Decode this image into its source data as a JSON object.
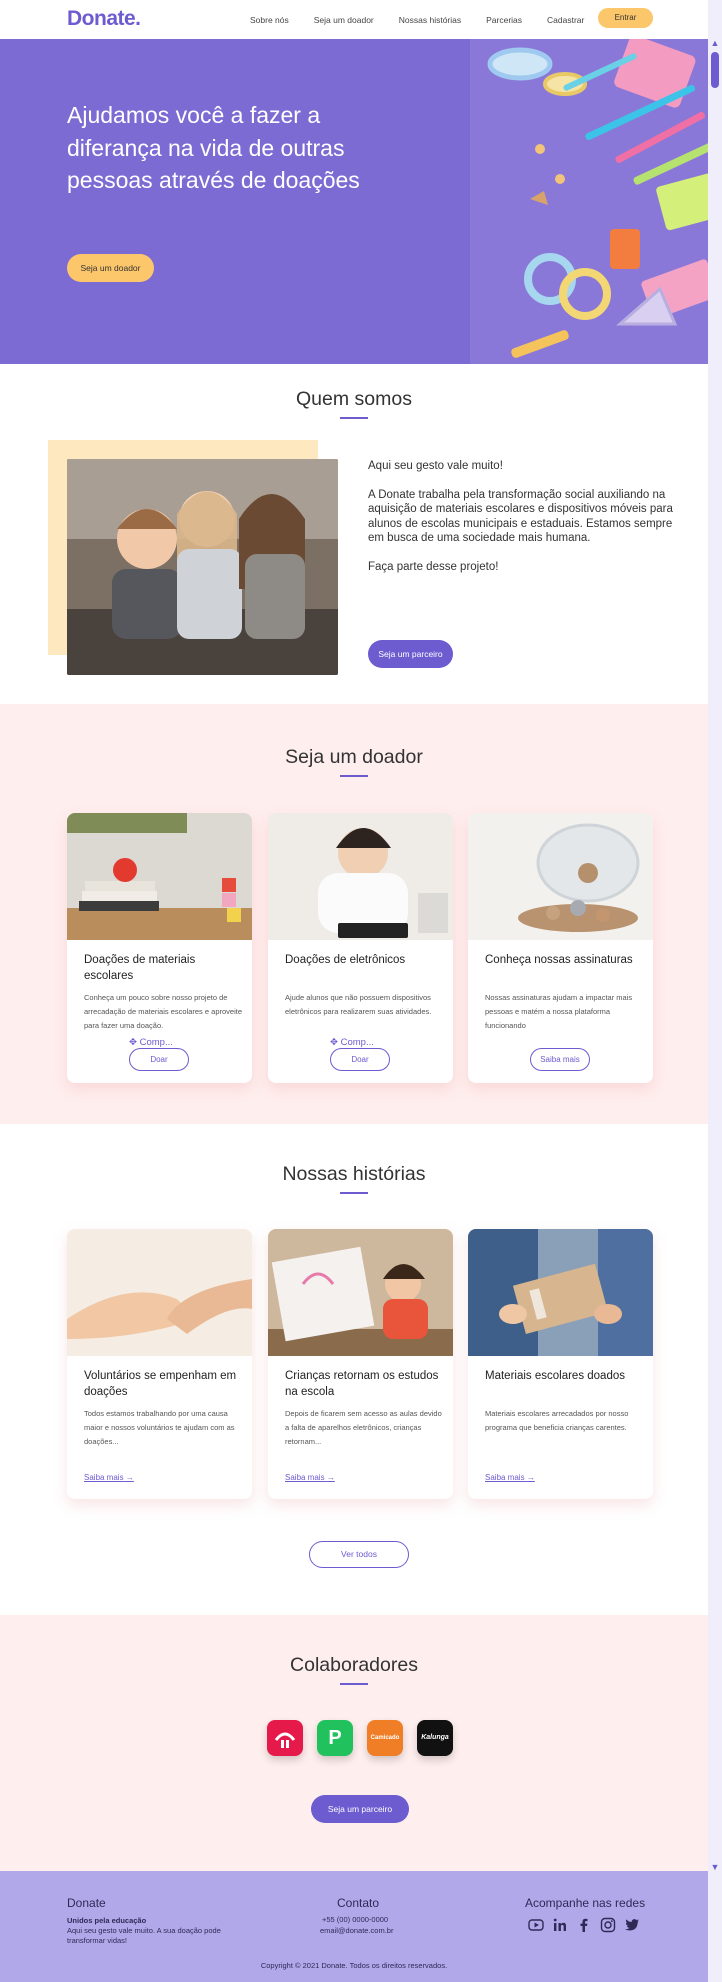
{
  "header": {
    "logo": "Donate.",
    "nav": [
      "Sobre nós",
      "Seja um doador",
      "Nossas histórias",
      "Parcerias",
      "Cadastrar"
    ],
    "login_label": "Entrar"
  },
  "hero": {
    "title": "Ajudamos você a fazer a diferança na vida de outras pessoas através de doações",
    "cta": "Seja um doador"
  },
  "about": {
    "title": "Quem somos",
    "p1": "Aqui seu gesto vale muito!",
    "p2": "A Donate trabalha pela transformação social auxiliando na aquisição de materiais escolares e dispositivos móveis para alunos de escolas municipais e estaduais. Estamos sempre em busca de uma sociedade mais humana.",
    "p3": "Faça parte desse projeto!",
    "cta": "Seja um parceiro"
  },
  "donor": {
    "title": "Seja um doador",
    "comp_tag": "Comp...",
    "cards": [
      {
        "title": "Doações de materiais escolares",
        "desc": "Conheça um pouco sobre nosso projeto de arrecadação de materiais escolares e aproveite para fazer uma doação.",
        "button": "Doar"
      },
      {
        "title": "Doações de eletrônicos",
        "desc": "Ajude alunos que não possuem dispositivos eletrônicos para realizarem suas atividades.",
        "button": "Doar"
      },
      {
        "title": "Conheça nossas assinaturas",
        "desc": "Nossas assinaturas ajudam a impactar mais pessoas e matém a nossa plataforma funcionando",
        "button": "Saiba mais"
      }
    ]
  },
  "stories": {
    "title": "Nossas histórias",
    "link_label": "Saiba mais",
    "see_all": "Ver todos",
    "cards": [
      {
        "title": "Voluntários se empenham em doações",
        "desc": "Todos estamos trabalhando por uma causa maior e nossos voluntários te ajudam com as doações..."
      },
      {
        "title": "Crianças retornam os estudos na escola",
        "desc": "Depois de ficarem sem acesso as aulas devido a falta de aparelhos eletrônicos, crianças retornam..."
      },
      {
        "title": "Materiais escolares doados",
        "desc": "Materiais escolares arrecadados por nosso programa que beneficia crianças carentes."
      }
    ]
  },
  "partners": {
    "title": "Colaboradores",
    "logos": [
      {
        "name": "bradesco-logo",
        "color": "#e6194b"
      },
      {
        "name": "picpay-logo",
        "color": "#21c25e",
        "text": "P"
      },
      {
        "name": "camicado-logo",
        "color": "#f07e26",
        "text": "Camicado"
      },
      {
        "name": "kalunga-logo",
        "color": "#111111",
        "text": "Kalunga"
      }
    ],
    "cta": "Seja um parceiro"
  },
  "footer": {
    "brand": "Donate",
    "tagline": "Unidos pela educação",
    "tagline_text": "Aqui seu gesto vale muito. A sua doação pode transformar vidas!",
    "contact_title": "Contato",
    "phone": "+55 (00) 0000-0000",
    "email": "email@donate.com.br",
    "social_title": "Acompanhe nas redes",
    "copyright": "Copyright © 2021 Donate. Todos os direitos reservados."
  },
  "colors": {
    "primary": "#6d5bd0",
    "accent": "#fcc76b",
    "pink": "#ffeeee",
    "footer": "#b1a8ea"
  }
}
